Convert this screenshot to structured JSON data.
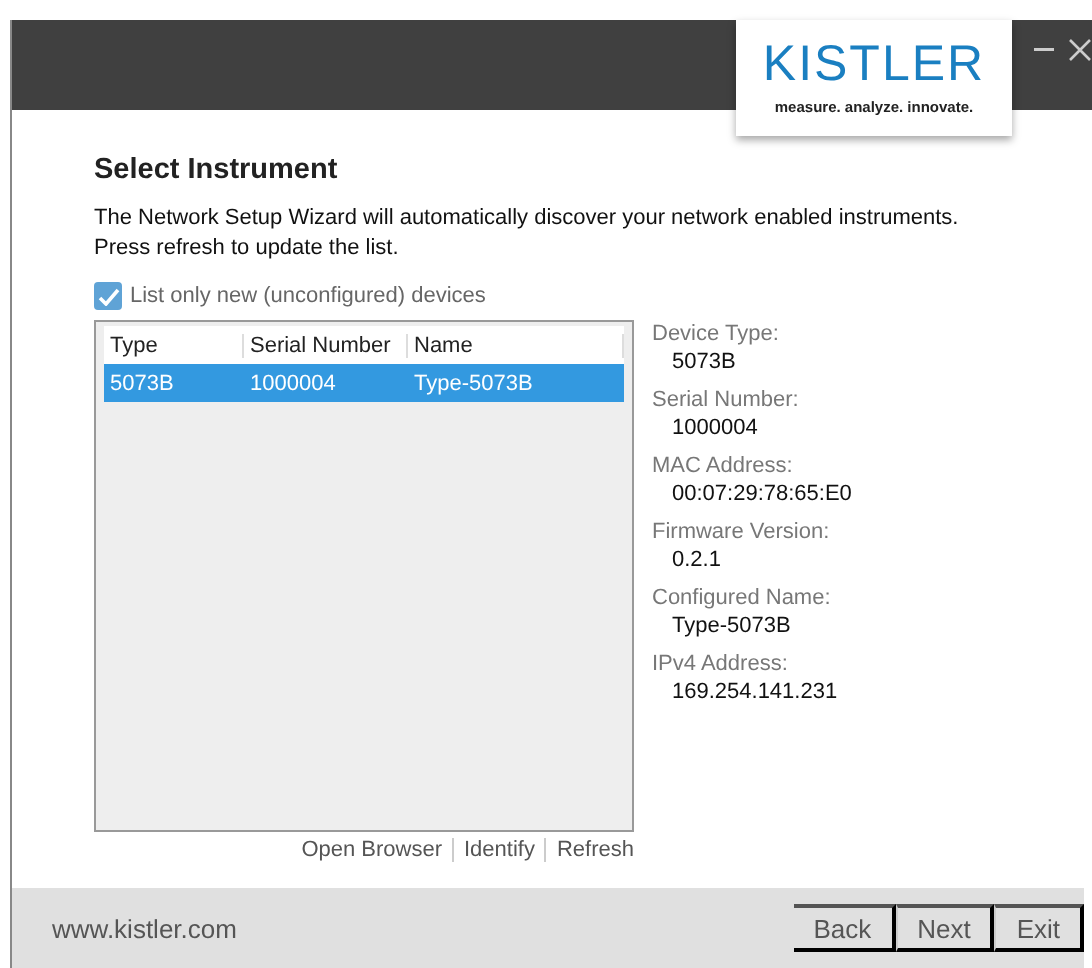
{
  "logo": {
    "name": "KISTLER",
    "tagline": "measure. analyze. innovate."
  },
  "heading": "Select Instrument",
  "description": "The Network Setup Wizard will automatically discover your network enabled instruments. Press refresh to update the list.",
  "filter": {
    "label": "List only new (unconfigured) devices",
    "checked": true
  },
  "table": {
    "columns": [
      "Type",
      "Serial Number",
      "Name"
    ],
    "rows": [
      {
        "cells": [
          "5073B",
          "1000004",
          "Type-5073B"
        ],
        "selected": true
      }
    ]
  },
  "details": [
    {
      "label": "Device Type:",
      "value": "5073B"
    },
    {
      "label": "Serial Number:",
      "value": "1000004"
    },
    {
      "label": "MAC Address:",
      "value": "00:07:29:78:65:E0"
    },
    {
      "label": "Firmware Version:",
      "value": "0.2.1"
    },
    {
      "label": "Configured Name:",
      "value": "Type-5073B"
    },
    {
      "label": "IPv4 Address:",
      "value": "169.254.141.231"
    }
  ],
  "links": [
    "Open Browser",
    "Identify",
    "Refresh"
  ],
  "footer": {
    "website": "www.kistler.com",
    "buttons": [
      "Back",
      "Next",
      "Exit"
    ]
  }
}
